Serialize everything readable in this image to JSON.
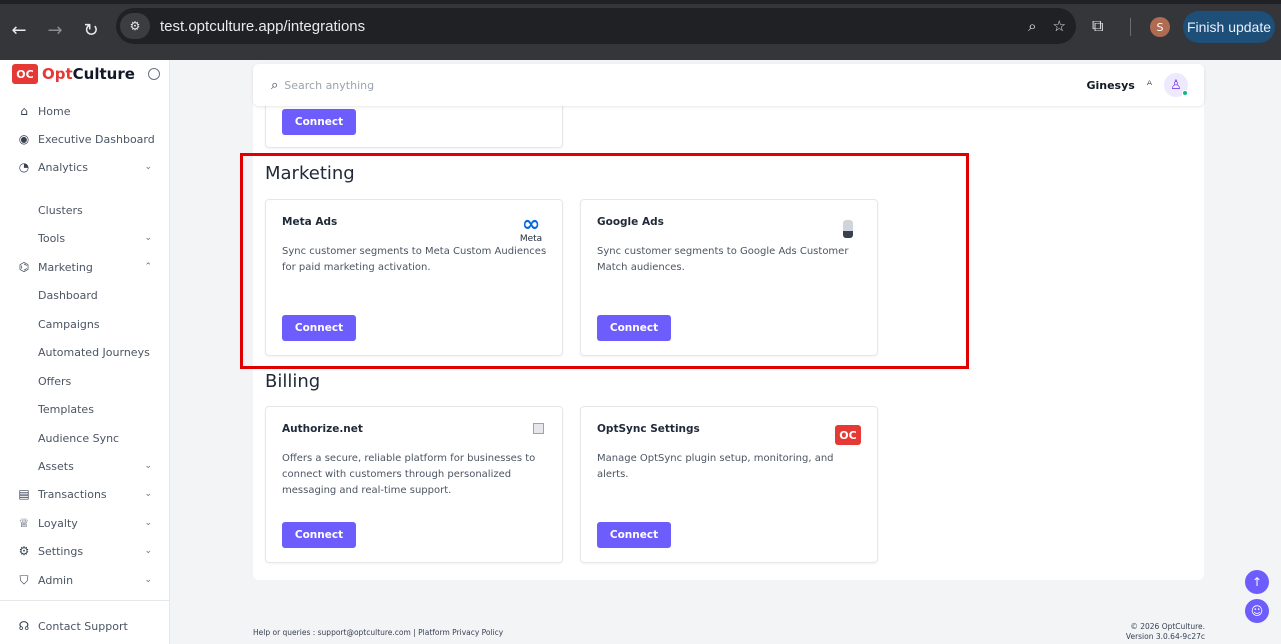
{
  "browser": {
    "url": "test.optculture.app/integrations",
    "finish_update_label": "Finish update",
    "profile_initial": "S"
  },
  "sidebar": {
    "brand_prefix": "Opt",
    "brand_suffix": "Culture",
    "brand_mark": "OC",
    "items": [
      {
        "label": "Home",
        "icon": "home-icon"
      },
      {
        "label": "Executive Dashboard",
        "icon": "gauge-icon"
      },
      {
        "label": "Analytics",
        "icon": "chart-icon"
      },
      {
        "label": "Clusters"
      },
      {
        "label": "Tools"
      },
      {
        "label": "Marketing",
        "icon": "megaphone-icon"
      },
      {
        "label": "Dashboard"
      },
      {
        "label": "Campaigns"
      },
      {
        "label": "Automated Journeys"
      },
      {
        "label": "Offers"
      },
      {
        "label": "Templates"
      },
      {
        "label": "Audience Sync"
      },
      {
        "label": "Assets"
      },
      {
        "label": "Transactions",
        "icon": "receipt-icon"
      },
      {
        "label": "Loyalty",
        "icon": "trophy-icon"
      },
      {
        "label": "Settings",
        "icon": "gear-icon"
      },
      {
        "label": "Admin",
        "icon": "shield-icon"
      }
    ],
    "contact_support": "Contact Support"
  },
  "header": {
    "search_placeholder": "Search anything",
    "org_name": "Ginesys"
  },
  "sections": {
    "marketing": {
      "title": "Marketing",
      "cards": [
        {
          "title": "Meta Ads",
          "description": "Sync customer segments to Meta Custom Audiences for paid marketing activation.",
          "logo_text": "Meta",
          "button": "Connect"
        },
        {
          "title": "Google Ads",
          "description": "Sync customer segments to Google Ads Customer Match audiences.",
          "button": "Connect"
        }
      ]
    },
    "billing": {
      "title": "Billing",
      "cards": [
        {
          "title": "Authorize.net",
          "description": "Offers a secure, reliable platform for businesses to connect with customers through personalized messaging and real-time support.",
          "button": "Connect"
        },
        {
          "title": "OptSync Settings",
          "description": "Manage OptSync plugin setup, monitoring, and alerts.",
          "logo_text": "OC",
          "button": "Connect"
        }
      ]
    },
    "top_partial": {
      "button": "Connect"
    }
  },
  "footer": {
    "help": "Help or queries : support@optculture.com  | Platform Privacy Policy",
    "copyright": "© 2026 OptCulture.",
    "version": "Version 3.0.64-9c27c"
  },
  "colors": {
    "accent": "#6d5dfc",
    "brand_red": "#e53935",
    "highlight": "#e00000"
  }
}
